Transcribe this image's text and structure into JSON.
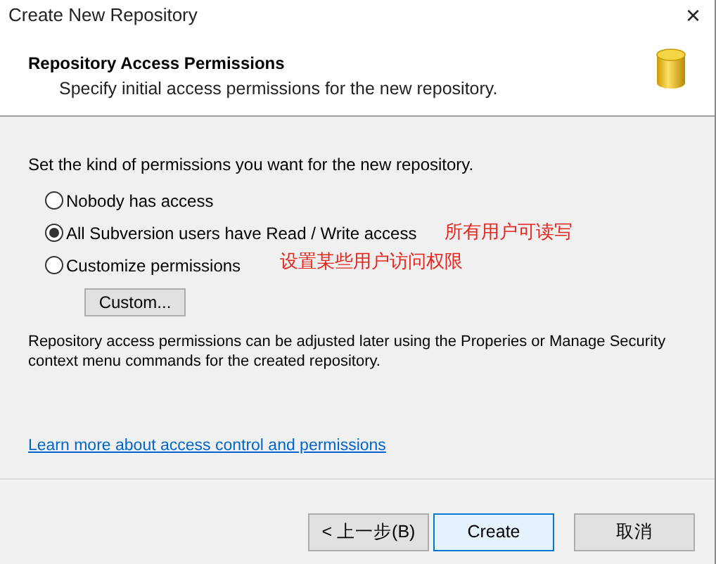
{
  "window": {
    "title": "Create New Repository",
    "close": "×"
  },
  "header": {
    "title": "Repository Access Permissions",
    "subtitle": "Specify initial access permissions for the new repository."
  },
  "intro": "Set the kind of permissions you want for the new repository.",
  "options": [
    {
      "label": "Nobody has access",
      "selected": false
    },
    {
      "label": "All Subversion users have Read / Write access",
      "selected": true,
      "annotation": "所有用户可读写"
    },
    {
      "label": "Customize permissions",
      "selected": false,
      "annotation": "设置某些用户访问权限"
    }
  ],
  "custom_button": "Custom...",
  "note": "Repository access permissions can be adjusted later using the Properies or Manage Security context menu commands for the created repository.",
  "link": "Learn more about access control and permissions",
  "buttons": [
    {
      "label": "< 上一步(B)",
      "default": false
    },
    {
      "label": "Create",
      "default": true
    },
    {
      "label": "取消",
      "default": false
    }
  ]
}
